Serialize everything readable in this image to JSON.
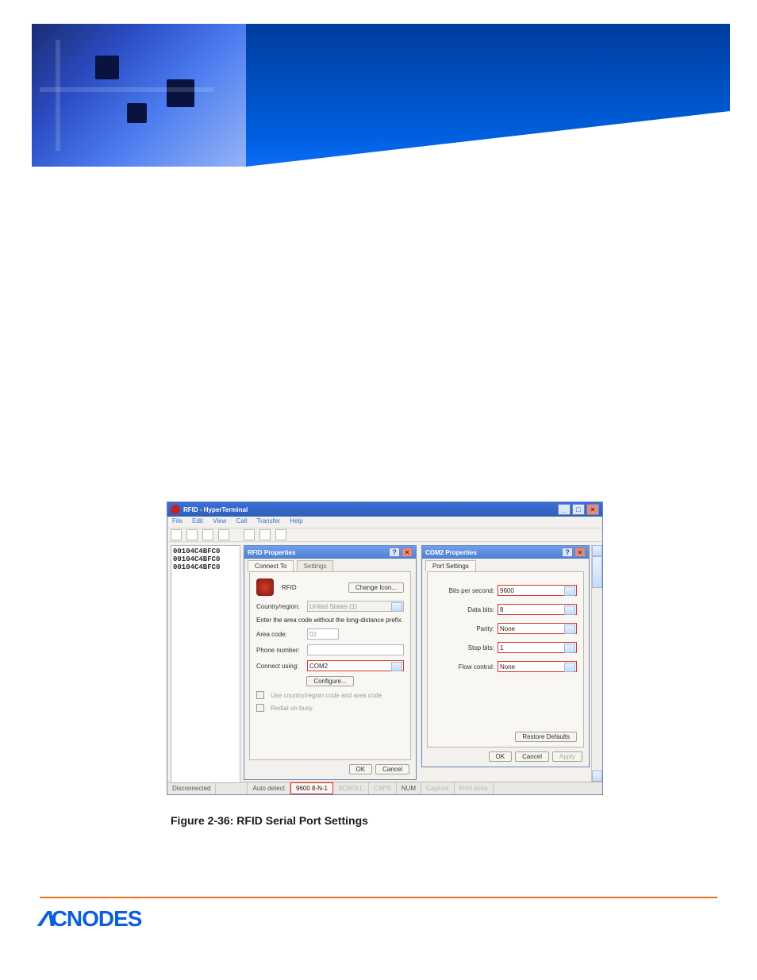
{
  "banner": {},
  "hyperterminal": {
    "window_title": "RFID - HyperTerminal",
    "menu": {
      "file": "File",
      "edit": "Edit",
      "view": "View",
      "call": "Call",
      "transfer": "Transfer",
      "help": "Help"
    },
    "term_lines": [
      "00104C4BFC0",
      "00104C4BFC0",
      "00104C4BFC0"
    ],
    "statusbar": {
      "conn": "Disconnected",
      "auto": "Auto detect",
      "mode": "9600 8-N-1",
      "scroll": "SCROLL",
      "caps": "CAPS",
      "num": "NUM",
      "capture": "Capture",
      "print": "Print echo"
    }
  },
  "rfid_props": {
    "title": "RFID Properties",
    "tabs": {
      "t1": "Connect To",
      "t2": "Settings"
    },
    "name": "RFID",
    "change_icon": "Change Icon...",
    "country_label": "Country/region:",
    "country_value": "United States (1)",
    "hint": "Enter the area code without the long-distance prefix.",
    "area_label": "Area code:",
    "area_value": "02",
    "phone_label": "Phone number:",
    "connect_label": "Connect using:",
    "connect_value": "COM2",
    "configure": "Configure...",
    "chk1": "Use country/region code and area code",
    "chk2": "Redial on busy",
    "ok": "OK",
    "cancel": "Cancel"
  },
  "com_props": {
    "title": "COM2 Properties",
    "tab": "Port Settings",
    "bps_label": "Bits per second:",
    "bps": "9600",
    "db_label": "Data bits:",
    "db": "8",
    "parity_label": "Parity:",
    "parity": "None",
    "sb_label": "Stop bits:",
    "sb": "1",
    "fc_label": "Flow control:",
    "fc": "None",
    "restore": "Restore Defaults",
    "ok": "OK",
    "cancel": "Cancel",
    "apply": "Apply"
  },
  "caption": "Figure 2-36: RFID Serial Port Settings",
  "footer": {
    "brand": "CNODES"
  }
}
